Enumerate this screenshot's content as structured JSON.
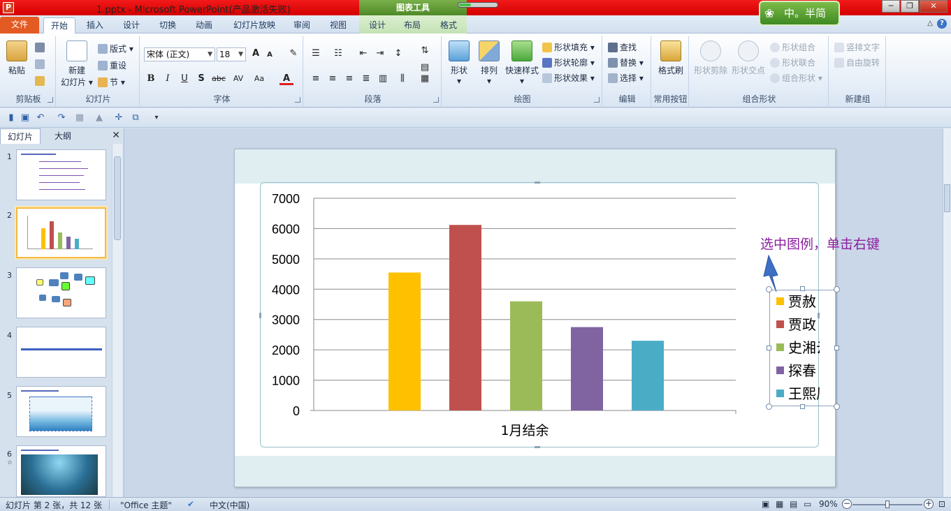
{
  "window": {
    "title": "1.pptx - Microsoft PowerPoint(产品激活失败)",
    "context_tab_group": "图表工具",
    "activation_progress": 0.3,
    "badge_text": "中。半简",
    "controls": {
      "minimize": "─",
      "restore": "❐",
      "close": "✕"
    }
  },
  "ribbon_tabs": {
    "file": "文件",
    "items": [
      "开始",
      "插入",
      "设计",
      "切换",
      "动画",
      "幻灯片放映",
      "审阅",
      "视图"
    ],
    "context_items": [
      "设计",
      "布局",
      "格式"
    ],
    "active": "开始"
  },
  "ribbon": {
    "clipboard": {
      "label": "剪贴板",
      "paste": "粘贴"
    },
    "slides": {
      "label": "幻灯片",
      "new_slide_line1": "新建",
      "new_slide_line2": "幻灯片",
      "layout": "版式",
      "reset": "重设",
      "section": "节"
    },
    "font": {
      "label": "字体",
      "font_name": "宋体 (正文)",
      "font_size": "18",
      "bold": "B",
      "italic": "I",
      "underline": "U",
      "shadow": "S",
      "strike": "abc",
      "spacing": "AV",
      "case": "Aa",
      "color": "A",
      "grow": "A",
      "shrink": "A"
    },
    "paragraph": {
      "label": "段落"
    },
    "drawing": {
      "label": "绘图",
      "shapes": "形状",
      "arrange": "排列",
      "quick_styles": "快速样式",
      "fill": "形状填充",
      "outline": "形状轮廓",
      "effects": "形状效果"
    },
    "editing": {
      "label": "编辑",
      "find": "查找",
      "replace": "替换",
      "select": "选择"
    },
    "common": {
      "label": "常用按钮",
      "format_painter": "格式刷"
    },
    "combine": {
      "label": "组合形状",
      "subtract": "形状剪除",
      "intersect": "形状交点",
      "combine": "形状组合",
      "union": "形状联合",
      "group": "组合形状"
    },
    "new_group": {
      "label": "新建组",
      "vertical_text": "竖排文字",
      "auto_rotate": "自由旋转"
    }
  },
  "panel": {
    "tabs": [
      "幻灯片",
      "大纲"
    ],
    "slide_numbers": [
      "1",
      "2",
      "3",
      "4",
      "5",
      "6"
    ],
    "selected_index": 1,
    "close": "✕",
    "slide6_mark": "☆"
  },
  "chart_data": {
    "type": "bar",
    "categories": [
      "1月结余"
    ],
    "series": [
      {
        "name": "贾赦",
        "values": [
          4550
        ],
        "color": "#ffc000"
      },
      {
        "name": "贾政",
        "values": [
          6120
        ],
        "color": "#c0504d"
      },
      {
        "name": "史湘云",
        "values": [
          3600
        ],
        "color": "#9bbb59"
      },
      {
        "name": "探春",
        "values": [
          2750
        ],
        "color": "#8064a2"
      },
      {
        "name": "王熙凤",
        "values": [
          2300
        ],
        "color": "#4bacc6"
      }
    ],
    "xlabel": "",
    "ylabel": "",
    "ylim": [
      0,
      7000
    ],
    "yticks": [
      0,
      1000,
      2000,
      3000,
      4000,
      5000,
      6000,
      7000
    ],
    "grid": true,
    "legend": "right",
    "legend_selected": true
  },
  "annotation": "选中图例，单击右键",
  "status": {
    "slide_info": "幻灯片 第 2 张，共 12 张",
    "theme": "\"Office 主题\"",
    "language": "中文(中国)",
    "zoom": "90%",
    "zoom_level": 0.5
  }
}
